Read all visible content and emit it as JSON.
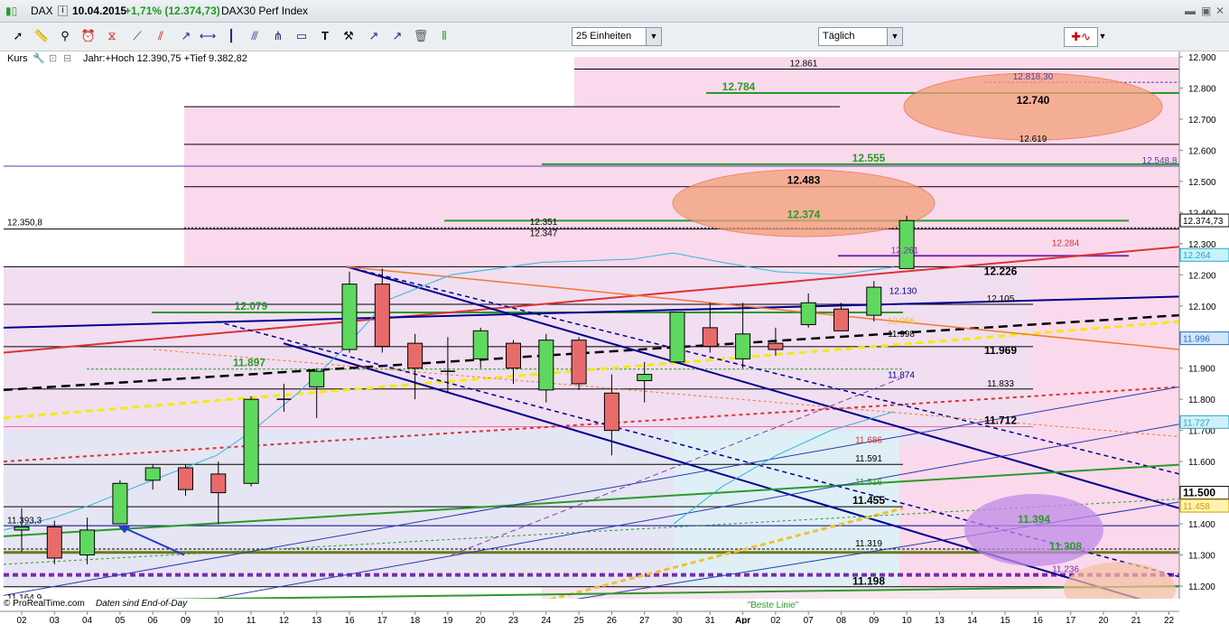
{
  "header": {
    "symbol": "DAX",
    "date": "10.04.2015",
    "change": "+1,71% (12.374,73)",
    "index_name": "DAX30 Perf Index"
  },
  "toolbar": {
    "period_select": "25 Einheiten",
    "interval_select": "Täglich",
    "tools": [
      "cursor-icon",
      "ruler-icon",
      "zoom-icon",
      "alarm-icon",
      "fibonacci-icon",
      "trendline-icon",
      "channel-icon",
      "ray-icon",
      "horizontal-line-icon",
      "vertical-line-icon",
      "parallel-icon",
      "pitchfork-icon",
      "rectangle-icon",
      "text-icon",
      "hammer-icon",
      "arrow-icon",
      "arrow-icon-2",
      "trash-icon",
      "indicator-icon"
    ]
  },
  "panel": {
    "label": "Kurs",
    "info": "Jahr:+Hoch 12.390,75 +Tief 9.382,82"
  },
  "footer": {
    "source": "© ProRealTime.com",
    "note": "Daten sind End-of-Day",
    "best_line": "\"Beste Linie\""
  },
  "colors": {
    "bull": "#5fd85f",
    "bear": "#e86b6b",
    "pink_zone": "#fbd9ec",
    "blue_zone": "#dde9f6",
    "navy": "#000090",
    "green_line": "#2a9a2a",
    "red_line": "#dd3333"
  },
  "chart_data": {
    "type": "candlestick",
    "x": [
      "02",
      "03",
      "04",
      "05",
      "06",
      "09",
      "10",
      "11",
      "12",
      "13",
      "16",
      "17",
      "18",
      "19",
      "20",
      "23",
      "24",
      "25",
      "26",
      "27",
      "30",
      "31",
      "Apr",
      "02",
      "07",
      "08",
      "09",
      "10",
      "13",
      "14",
      "15",
      "16",
      "17",
      "20",
      "21",
      "22"
    ],
    "ohlc": [
      [
        11380,
        11450,
        11310,
        11390
      ],
      [
        11390,
        11410,
        11270,
        11290
      ],
      [
        11300,
        11420,
        11270,
        11380
      ],
      [
        11400,
        11540,
        11400,
        11530
      ],
      [
        11540,
        11590,
        11510,
        11580
      ],
      [
        11580,
        11590,
        11490,
        11510
      ],
      [
        11560,
        11600,
        11400,
        11500
      ],
      [
        11530,
        11810,
        11520,
        11800
      ],
      [
        11800,
        11850,
        11760,
        11800
      ],
      [
        11840,
        11900,
        11740,
        11890
      ],
      [
        11960,
        12210,
        11950,
        12170
      ],
      [
        12170,
        12220,
        11950,
        11970
      ],
      [
        11980,
        12010,
        11800,
        11900
      ],
      [
        11890,
        12000,
        11820,
        11890
      ],
      [
        11930,
        12030,
        11900,
        12020
      ],
      [
        11980,
        11990,
        11850,
        11900
      ],
      [
        11830,
        12010,
        11790,
        11990
      ],
      [
        11990,
        12000,
        11830,
        11850
      ],
      [
        11820,
        11880,
        11620,
        11700
      ],
      [
        11860,
        11920,
        11790,
        11880
      ],
      [
        11920,
        12080,
        11920,
        12080
      ],
      [
        12030,
        12110,
        11950,
        11970
      ],
      [
        11930,
        12110,
        11900,
        12010
      ],
      [
        11980,
        12030,
        11940,
        11960
      ],
      [
        12040,
        12140,
        12030,
        12110
      ],
      [
        12090,
        12110,
        12020,
        12020
      ],
      [
        12070,
        12180,
        12050,
        12160
      ],
      [
        12220,
        12390,
        12220,
        12374
      ]
    ],
    "ylim": [
      11150,
      12930
    ],
    "yticks": [
      "12.900",
      "12.800",
      "12.700",
      "12.600",
      "12.500",
      "12.400",
      "12.300",
      "12.200",
      "12.100",
      "12.000",
      "11.900",
      "11.800",
      "11.700",
      "11.600",
      "11.500",
      "11.400",
      "11.300",
      "11.200"
    ],
    "levels": [
      {
        "value": 12861,
        "label": "12.861",
        "color": "#000000"
      },
      {
        "value": 12818.3,
        "label": "12.818,30",
        "color": "#5a3ab0"
      },
      {
        "value": 12784,
        "label": "12.784",
        "color": "#2a9a2a"
      },
      {
        "value": 12740,
        "label": "12.740",
        "color": "#000000"
      },
      {
        "value": 12619,
        "label": "12.619",
        "color": "#000000"
      },
      {
        "value": 12555,
        "label": "12.555",
        "color": "#2a9a2a"
      },
      {
        "value": 12548.8,
        "label": "12.548,8",
        "color": "#5a3ab0"
      },
      {
        "value": 12483,
        "label": "12.483",
        "color": "#000000"
      },
      {
        "value": 12374,
        "label": "12.374",
        "color": "#2a9a2a"
      },
      {
        "value": 12374.73,
        "label": "12.374,73",
        "color": "#5a3ab0"
      },
      {
        "value": 12351,
        "label": "12.351",
        "color": "#000000"
      },
      {
        "value": 12350.8,
        "label": "12.350,8",
        "color": "#000000"
      },
      {
        "value": 12347,
        "label": "12.347",
        "color": "#000000"
      },
      {
        "value": 12284,
        "label": "12.284",
        "color": "#dd3333"
      },
      {
        "value": 12264,
        "label": "12.264",
        "color": "#2aa7c4"
      },
      {
        "value": 12261,
        "label": "12.261",
        "color": "#7a2ab0"
      },
      {
        "value": 12226,
        "label": "12.226",
        "color": "#000000"
      },
      {
        "value": 12130,
        "label": "12.130",
        "color": "#000090"
      },
      {
        "value": 12105,
        "label": "12.105",
        "color": "#000000"
      },
      {
        "value": 12079,
        "label": "12.079",
        "color": "#2a9a2a"
      },
      {
        "value": 12066,
        "label": "12.066",
        "color": "#f0c030"
      },
      {
        "value": 11998,
        "label": "11.998",
        "color": "#000000"
      },
      {
        "value": 11996,
        "label": "11.996",
        "color": "#2a6ac4"
      },
      {
        "value": 11969,
        "label": "11.969",
        "color": "#000000"
      },
      {
        "value": 11897,
        "label": "11.897",
        "color": "#2a9a2a"
      },
      {
        "value": 11874,
        "label": "11.874",
        "color": "#000090"
      },
      {
        "value": 11833,
        "label": "11.833",
        "color": "#000000"
      },
      {
        "value": 11727,
        "label": "11.727",
        "color": "#2aa7c4"
      },
      {
        "value": 11712,
        "label": "11.712",
        "color": "#000000"
      },
      {
        "value": 11686,
        "label": "11.686",
        "color": "#dd3333"
      },
      {
        "value": 11591,
        "label": "11.591",
        "color": "#000000"
      },
      {
        "value": 11516,
        "label": "11.516",
        "color": "#2a9a2a"
      },
      {
        "value": 11500,
        "label": "11.500",
        "color": "#000000"
      },
      {
        "value": 11458,
        "label": "11.458",
        "color": "#f0c030"
      },
      {
        "value": 11455,
        "label": "11.455",
        "color": "#000000"
      },
      {
        "value": 11394,
        "label": "11.394",
        "color": "#2a9a2a"
      },
      {
        "value": 11393.3,
        "label": "11.393,3",
        "color": "#000000"
      },
      {
        "value": 11319,
        "label": "11.319",
        "color": "#000000"
      },
      {
        "value": 11308,
        "label": "11.308",
        "color": "#2a9a2a"
      },
      {
        "value": 11236,
        "label": "11.236",
        "color": "#7a2ab0"
      },
      {
        "value": 11198,
        "label": "11.198",
        "color": "#000000"
      },
      {
        "value": 11164.9,
        "label": "11.164,9",
        "color": "#000000"
      }
    ],
    "grid": false,
    "legend": "none"
  }
}
